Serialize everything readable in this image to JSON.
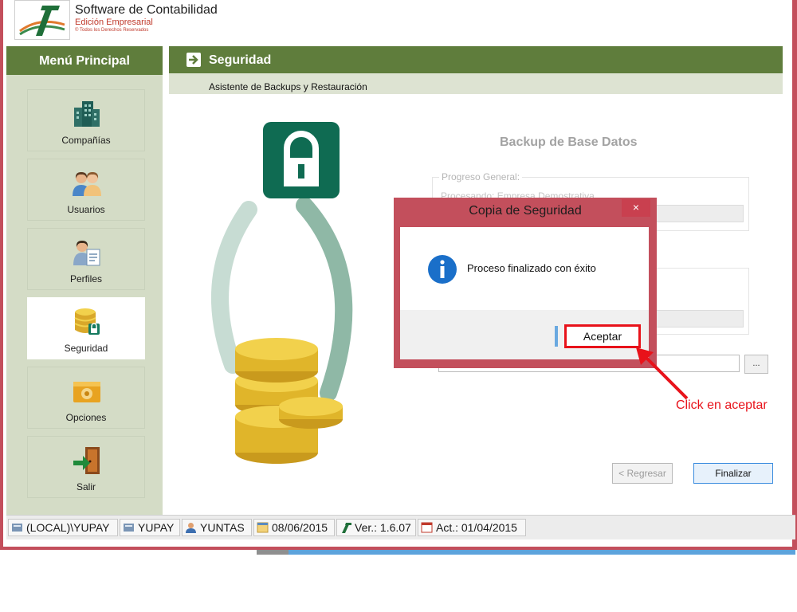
{
  "app": {
    "title": "Software de Contabilidad",
    "edition": "Edición Empresarial",
    "rights": "© Todos los Derechos Reservados"
  },
  "sidebar": {
    "header": "Menú Principal",
    "items": [
      {
        "label": "Compañías"
      },
      {
        "label": "Usuarios"
      },
      {
        "label": "Perfiles"
      },
      {
        "label": "Seguridad"
      },
      {
        "label": "Opciones"
      },
      {
        "label": "Salir"
      }
    ]
  },
  "main": {
    "title": "Seguridad",
    "subtitle": "Asistente de Backups y Restauración",
    "wizard_title": "Backup de Base Datos",
    "group_legend": "Progreso General:",
    "group_text": "Procesando: Empresa Demostrativa",
    "browse_label": "...",
    "back_label": "< Regresar",
    "finish_label": "Finalizar"
  },
  "dialog": {
    "title": "Copia de Seguridad",
    "close_label": "×",
    "message": "Proceso finalizado con éxito",
    "accept_label": "Aceptar"
  },
  "annotation": "Click en aceptar",
  "status": {
    "server": "(LOCAL)\\YUPAY",
    "database": "YUPAY",
    "user": "YUNTAS",
    "date": "08/06/2015",
    "version": "Ver.: 1.6.07",
    "updated": "Act.: 01/04/2015"
  },
  "colors": {
    "window_border": "#c34f5c",
    "header_green": "#5f7d3c",
    "sidebar_bg": "#d4dcc6",
    "highlight_red": "#e8121a"
  }
}
